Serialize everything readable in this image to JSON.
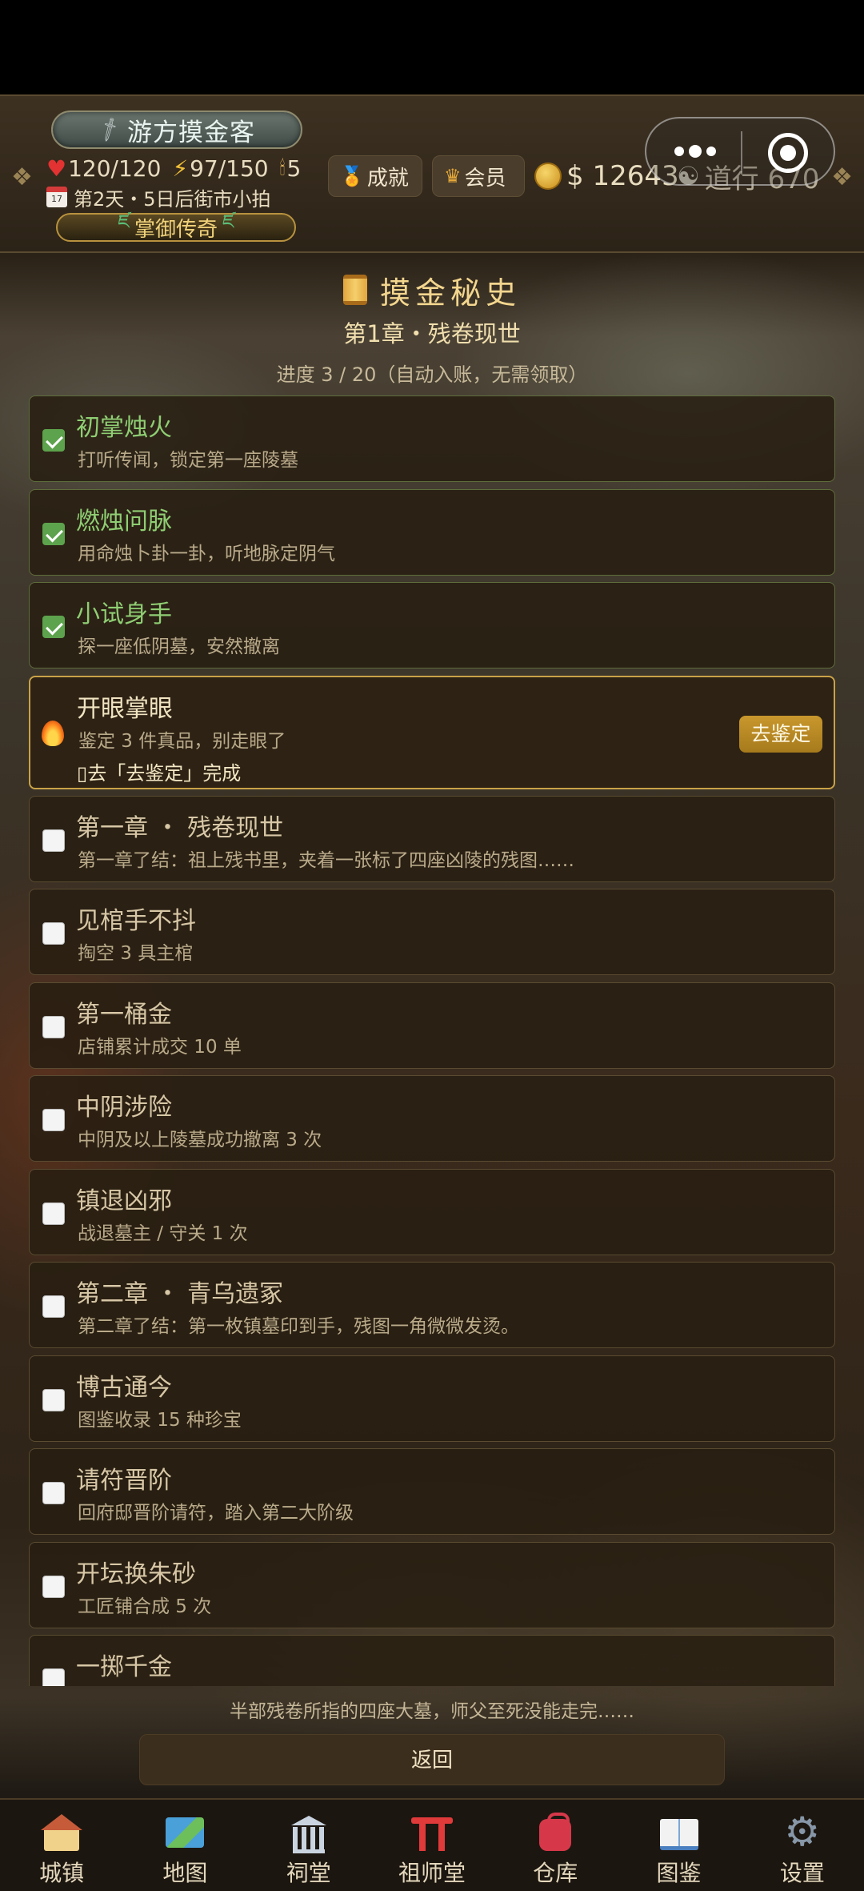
{
  "header": {
    "player_name": "游方摸金客",
    "hp": "120/120",
    "energy": "97/150",
    "candles": "5",
    "day_info": "第2天・5日后街市小拍",
    "title_badge": "掌御传奇",
    "achievements_label": "成就",
    "member_label": "会员",
    "money": "$ 12643",
    "taoism": "道行 670",
    "calendar_day": "17"
  },
  "page": {
    "title": "摸金秘史",
    "chapter": "第1章・残卷现世",
    "progress": "进度 3 / 20（自动入账，无需领取）"
  },
  "quests": [
    {
      "title": "初掌烛火",
      "desc": "打听传闻，锁定第一座陵墓",
      "status": "done"
    },
    {
      "title": "燃烛问脉",
      "desc": "用命烛卜卦一卦，听地脉定阴气",
      "status": "done"
    },
    {
      "title": "小试身手",
      "desc": "探一座低阴墓，安然撤离",
      "status": "done"
    },
    {
      "title": "开眼掌眼",
      "desc": "鉴定 3 件真品，别走眼了",
      "hint": "▯去「去鉴定」完成",
      "action": "去鉴定",
      "status": "active"
    },
    {
      "title": "第一章 ・ 残卷现世",
      "desc": "第一章了结：祖上残书里，夹着一张标了四座凶陵的残图……",
      "status": "pending"
    },
    {
      "title": "见棺手不抖",
      "desc": "掏空 3 具主棺",
      "status": "pending"
    },
    {
      "title": "第一桶金",
      "desc": "店铺累计成交 10 单",
      "status": "pending"
    },
    {
      "title": "中阴涉险",
      "desc": "中阴及以上陵墓成功撤离 3 次",
      "status": "pending"
    },
    {
      "title": "镇退凶邪",
      "desc": "战退墓主 / 守关 1 次",
      "status": "pending"
    },
    {
      "title": "第二章 ・ 青乌遗冢",
      "desc": "第二章了结：第一枚镇墓印到手，残图一角微微发烫。",
      "status": "pending"
    },
    {
      "title": "博古通今",
      "desc": "图鉴收录 15 种珍宝",
      "status": "pending"
    },
    {
      "title": "请符晋阶",
      "desc": "回府邸晋阶请符，踏入第二大阶级",
      "status": "pending"
    },
    {
      "title": "开坛换朱砂",
      "desc": "工匠铺合成 5 次",
      "status": "pending"
    },
    {
      "title": "一掷千金",
      "desc": "",
      "status": "pending"
    }
  ],
  "footer": {
    "quote": "半部残卷所指的四座大墓，师父至死没能走完……",
    "back_label": "返回"
  },
  "nav": [
    {
      "label": "城镇",
      "icon": "house-icon"
    },
    {
      "label": "地图",
      "icon": "map-icon"
    },
    {
      "label": "祠堂",
      "icon": "temple-icon"
    },
    {
      "label": "祖师堂",
      "icon": "torii-icon"
    },
    {
      "label": "仓库",
      "icon": "backpack-icon"
    },
    {
      "label": "图鉴",
      "icon": "book-icon"
    },
    {
      "label": "设置",
      "icon": "gear-icon"
    }
  ],
  "colors": {
    "accent_gold": "#c9982d",
    "done_green": "#8fce73",
    "active_border": "#c9a248"
  }
}
